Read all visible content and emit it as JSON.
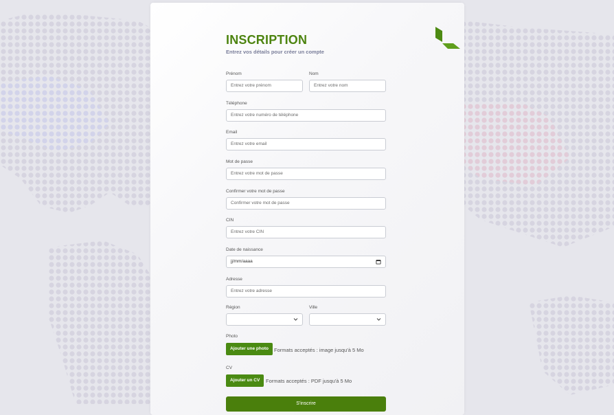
{
  "form": {
    "title": "INSCRIPTION",
    "subtitle": "Entrez vos détails pour créer un compte",
    "fields": {
      "prenom": {
        "label": "Prénom",
        "placeholder": "Entrez votre prénom"
      },
      "nom": {
        "label": "Nom",
        "placeholder": "Entrez votre nom"
      },
      "telephone": {
        "label": "Téléphone",
        "placeholder": "Entrez votre numéro de téléphone"
      },
      "email": {
        "label": "Email",
        "placeholder": "Entrez votre email"
      },
      "mot_de_passe": {
        "label": "Mot de passe",
        "placeholder": "Entrez votre mot de passe"
      },
      "confirmer": {
        "label": "Confirmer votre mot de passe",
        "placeholder": "Confirmer votre mot de passe"
      },
      "cin": {
        "label": "CIN",
        "placeholder": "Entrez votre CIN"
      },
      "date_naissance": {
        "label": "Date de naissance",
        "placeholder": "jj/mm/aaaa"
      },
      "adresse": {
        "label": "Adresse",
        "placeholder": "Entrez votre adresse"
      },
      "region": {
        "label": "Région",
        "value": ""
      },
      "ville": {
        "label": "Ville",
        "value": ""
      }
    },
    "photo": {
      "label": "Photo",
      "button": "Ajouter une photo",
      "hint": "Formats acceptés : image jusqu'à 5 Mo"
    },
    "cv": {
      "label": "CV",
      "button": "Ajouter un CV",
      "hint": "Formats acceptés : PDF jusqu'à 5 Mo"
    },
    "submit": "S'inscrire"
  },
  "colors": {
    "accent": "#4a8a12",
    "title": "#4d8410",
    "background": "#e6e6ec"
  },
  "icons": {
    "logo": "logo-icon",
    "calendar": "calendar-icon",
    "select": "chevron-down-icon"
  }
}
